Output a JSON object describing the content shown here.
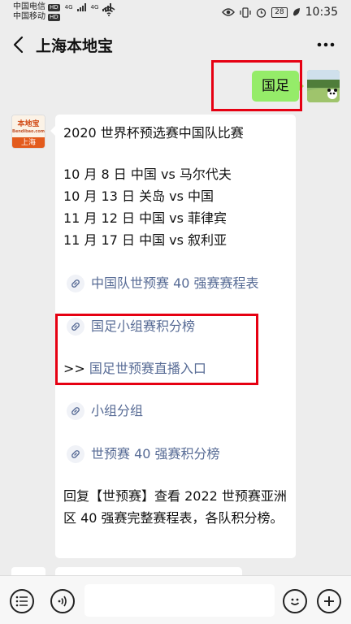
{
  "status_bar": {
    "carrier1": "中国电信",
    "carrier2": "中国移动",
    "hd": "HD",
    "net": "4G",
    "battery": "28",
    "time": "10:35"
  },
  "header": {
    "title": "上海本地宝"
  },
  "outgoing": {
    "text": "国足"
  },
  "account_logo": {
    "top": "本地宝",
    "site": "Bendibao.com",
    "city": "上海"
  },
  "message": {
    "title": "2020 世界杯预选赛中国队比赛",
    "matches": [
      "10 月 8 日 中国 vs 马尔代夫",
      "10 月 13 日 关岛 vs 中国",
      "11 月 12 日 中国 vs 菲律宾",
      "11 月 17 日 中国 vs 叙利亚"
    ],
    "links": [
      "中国队世预赛 40 强赛赛程表",
      "国足小组赛积分榜",
      "小组分组",
      "世预赛 40 强赛积分榜"
    ],
    "live_prefix": ">>",
    "live_link": "国足世预赛直播入口",
    "footer": "回复【世预赛】查看 2022 世预赛亚洲区 40 强赛完整赛程表，各队积分榜。"
  },
  "colors": {
    "background": "#ededed",
    "outgoing_bubble": "#95ec69",
    "link": "#576b95",
    "highlight_box": "#e60012"
  },
  "icons": [
    "back-icon",
    "more-icon",
    "link-icon",
    "list-icon",
    "voice-icon",
    "emoji-icon",
    "plus-icon"
  ]
}
